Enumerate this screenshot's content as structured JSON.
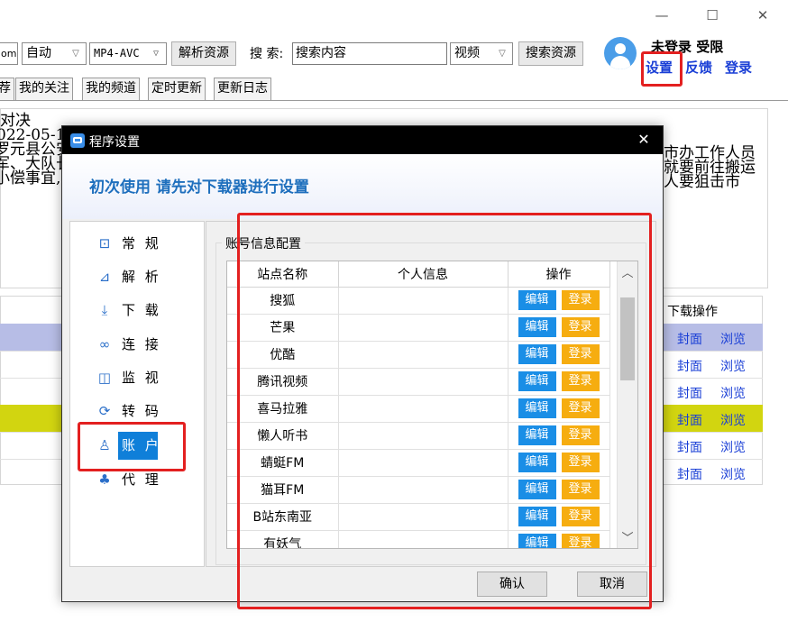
{
  "window": {
    "minimize": "—",
    "maximize": "☐",
    "close": "✕"
  },
  "toolbar": {
    "combo_edge": "om",
    "auto_combo": "自动",
    "format_combo": "MP4-AVC",
    "parse_button": "解析资源",
    "search_label": "搜 索:",
    "search_value": "搜索内容",
    "type_combo": "视频",
    "search_button": "搜索资源"
  },
  "user": {
    "status": "未登录 受限",
    "settings": "设置",
    "feedback": "反馈",
    "login": "登录"
  },
  "tabs": [
    "荐",
    "我的关注",
    "我的频道",
    "定时更新",
    "更新日志"
  ],
  "background": {
    "left_lines": [
      "对决",
      "022-05-1",
      "罗元县公安",
      "军、大队长",
      "小偿事宜,"
    ],
    "right_lines": [
      "市办工作人员",
      "就要前往搬运",
      "人要狙击市"
    ],
    "list_header": "下载操作",
    "rows": [
      {
        "cover": "封面",
        "browse": "浏览"
      },
      {
        "cover": "封面",
        "browse": "浏览"
      },
      {
        "cover": "封面",
        "browse": "浏览"
      },
      {
        "cover": "封面",
        "browse": "浏览"
      },
      {
        "cover": "封面",
        "browse": "浏览"
      },
      {
        "cover": "封面",
        "browse": "浏览"
      }
    ]
  },
  "dialog": {
    "title": "程序设置",
    "close": "✕",
    "banner": "初次使用 请先对下载器进行设置",
    "nav": [
      {
        "label": "常 规",
        "icon": "monitor-icon"
      },
      {
        "label": "解 析",
        "icon": "chart-icon"
      },
      {
        "label": "下 载",
        "icon": "download-icon"
      },
      {
        "label": "连 接",
        "icon": "link-icon"
      },
      {
        "label": "监 视",
        "icon": "watch-icon"
      },
      {
        "label": "转 码",
        "icon": "transcode-icon"
      },
      {
        "label": "账 户",
        "icon": "user-icon"
      },
      {
        "label": "代 理",
        "icon": "network-icon"
      }
    ],
    "group_title": "账号信息配置",
    "columns": [
      "站点名称",
      "个人信息",
      "操作"
    ],
    "edit_label": "编辑",
    "login_label": "登录",
    "sites": [
      "搜狐",
      "芒果",
      "优酷",
      "腾讯视频",
      "喜马拉雅",
      "懒人听书",
      "蜻蜓FM",
      "猫耳FM",
      "B站东南亚",
      "有妖气"
    ],
    "ok": "确认",
    "cancel": "取消"
  }
}
